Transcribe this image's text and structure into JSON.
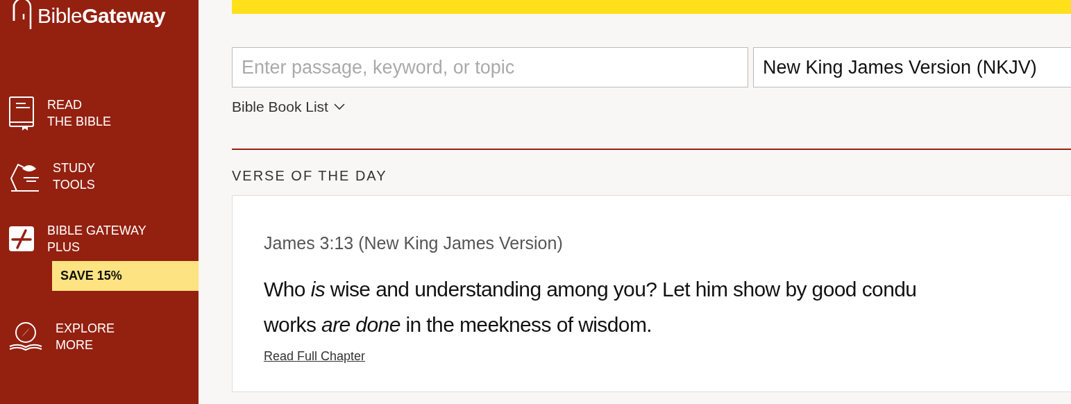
{
  "sidebar": {
    "logo": "Bible**Gateway**",
    "items": [
      {
        "kind": "book",
        "lines": [
          "READ",
          "THE BIBLE"
        ]
      },
      {
        "kind": "lamp",
        "lines": [
          "STUDY",
          "TOOLS"
        ]
      },
      {
        "kind": "plus",
        "lines": [
          "BIBLE GATEWAY",
          "PLUS"
        ],
        "badge": "SAVE 15%"
      },
      {
        "kind": "compass",
        "lines": [
          "EXPLORE",
          "MORE"
        ]
      }
    ]
  },
  "search": {
    "placeholder": "Enter passage, keyword, or topic",
    "version": "New King James Version (NKJV)",
    "book_list": "Bible Book List"
  },
  "verse_of_the_day": {
    "heading": "VERSE OF THE DAY",
    "reference": "James 3:13 (New King James Version)",
    "lines": [
      "Who *is* wise and understanding among you? Let him show by good condu",
      "works *are done* in the meekness of wisdom."
    ],
    "link": "Read Full Chapter"
  }
}
